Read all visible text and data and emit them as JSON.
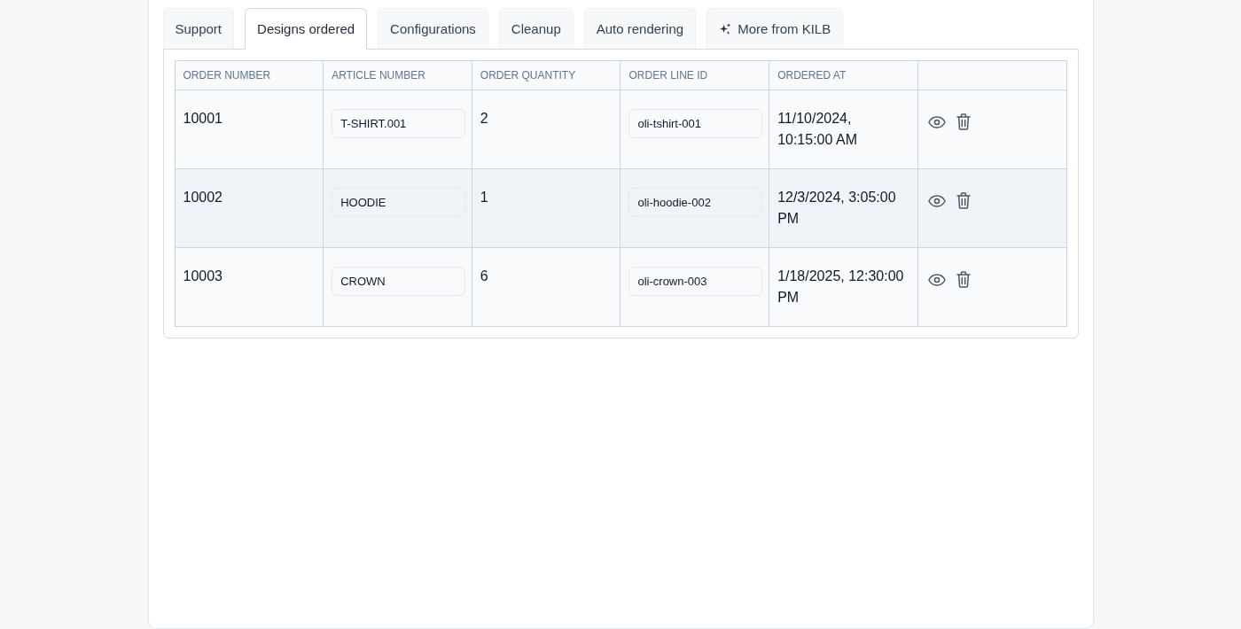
{
  "tabs": [
    {
      "label": "Support",
      "selected": false,
      "kind": "plain"
    },
    {
      "label": "Designs ordered",
      "selected": true,
      "kind": "plain"
    },
    {
      "label": "Configurations",
      "selected": false,
      "kind": "plain"
    },
    {
      "label": "Cleanup",
      "selected": false,
      "kind": "plain"
    },
    {
      "label": "Auto rendering",
      "selected": false,
      "kind": "plain"
    },
    {
      "label": "More from KILB",
      "selected": false,
      "kind": "sparkle"
    }
  ],
  "table": {
    "columns": [
      "ORDER NUMBER",
      "ARTICLE NUMBER",
      "ORDER QUANTITY",
      "ORDER LINE ID",
      "ORDERED AT"
    ],
    "rows": [
      {
        "order_number": "10001",
        "article_number": "T-SHIRT.001",
        "order_quantity": "2",
        "order_line_id": "oli-tshirt-001",
        "ordered_at": "11/10/2024, 10:15:00 AM"
      },
      {
        "order_number": "10002",
        "article_number": "HOODIE",
        "order_quantity": "1",
        "order_line_id": "oli-hoodie-002",
        "ordered_at": "12/3/2024, 3:05:00 PM"
      },
      {
        "order_number": "10003",
        "article_number": "CROWN",
        "order_quantity": "6",
        "order_line_id": "oli-crown-003",
        "ordered_at": "1/18/2025, 12:30:00 PM"
      }
    ]
  }
}
